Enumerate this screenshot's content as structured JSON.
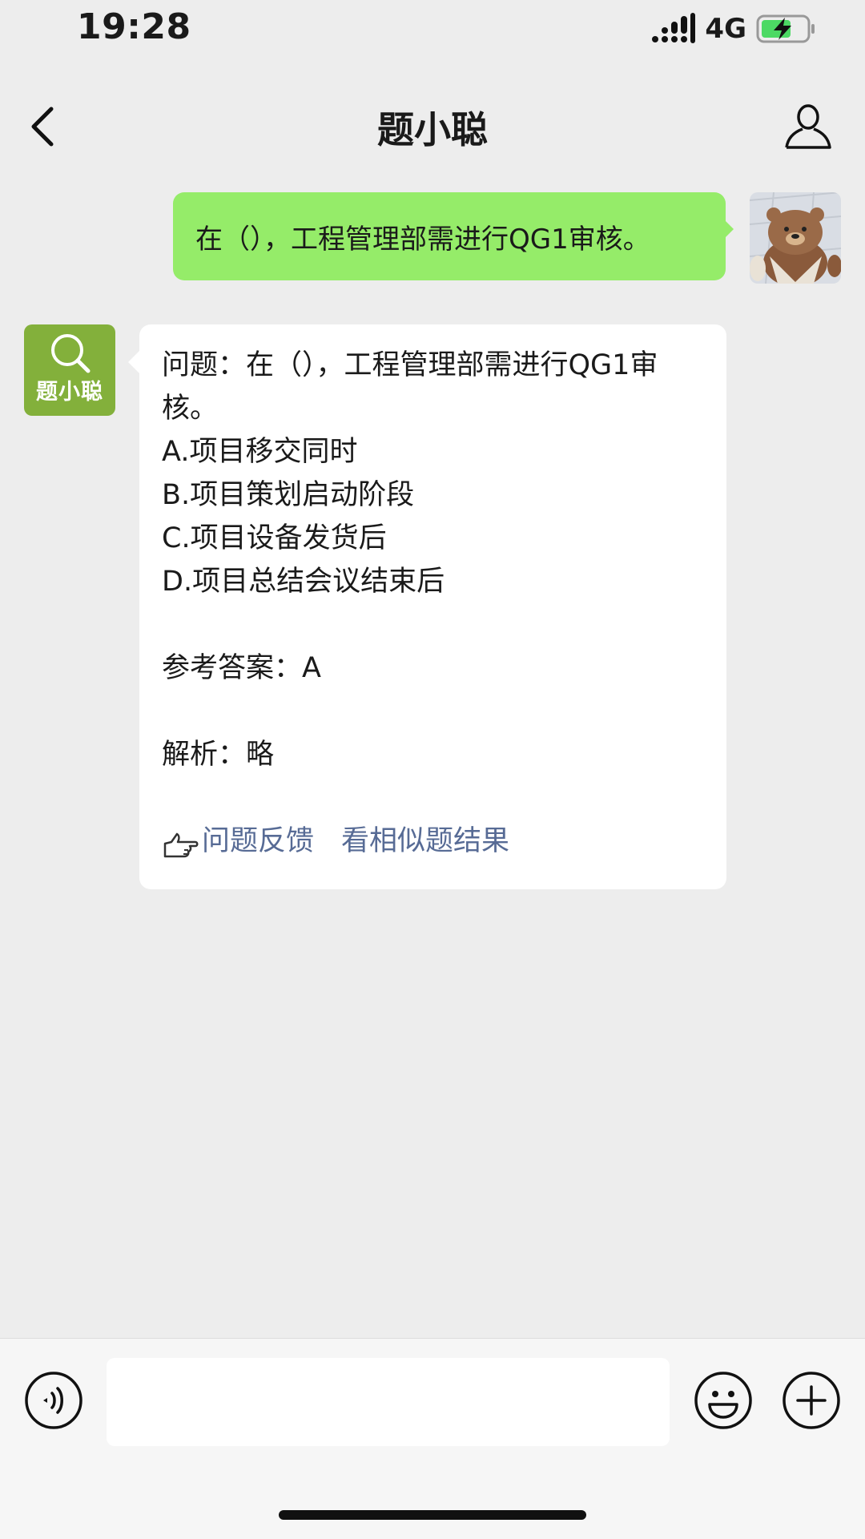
{
  "status_bar": {
    "time": "19:28",
    "network": "4G",
    "icons": [
      "signal-icon",
      "battery-charging-icon"
    ]
  },
  "nav": {
    "title": "题小聪",
    "icons": [
      "back-icon",
      "contact-icon"
    ]
  },
  "outgoing_message": {
    "text": "在（），工程管理部需进行QG1审核。",
    "avatar": "bear-avatar"
  },
  "incoming_message": {
    "avatar_label": "题小聪",
    "avatar_icon": "search-icon",
    "question": "问题：在（），工程管理部需进行QG1审核。",
    "options": [
      "A.项目移交同时",
      "B.项目策划启动阶段",
      "C.项目设备发货后",
      "D.项目总结会议结束后"
    ],
    "answer": "参考答案：A",
    "analysis": "解析：略",
    "feedback_link": "问题反馈",
    "similar_link": "看相似题结果",
    "link_color": "#576b95"
  },
  "input_bar": {
    "value": "",
    "icons": [
      "voice-icon",
      "emoji-icon",
      "plus-icon"
    ]
  },
  "colors": {
    "background": "#ededed",
    "outgoing_bubble": "#95ec69",
    "incoming_bubble": "#ffffff",
    "bot_avatar": "#83b03b"
  }
}
